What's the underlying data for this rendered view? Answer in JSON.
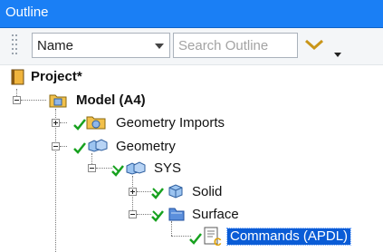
{
  "panel": {
    "title": "Outline"
  },
  "toolbar": {
    "sort_select": "Name",
    "search_placeholder": "Search Outline"
  },
  "tree": {
    "project": "Project*",
    "model": "Model (A4)",
    "geometry_imports": "Geometry Imports",
    "geometry": "Geometry",
    "sys": "SYS",
    "solid": "Solid",
    "surface": "Surface",
    "commands": "Commands (APDL)"
  },
  "colors": {
    "title_bar": "#1a7ff5",
    "selection": "#0a5cd6",
    "check": "#17a11f",
    "cross": "#17a11f"
  }
}
